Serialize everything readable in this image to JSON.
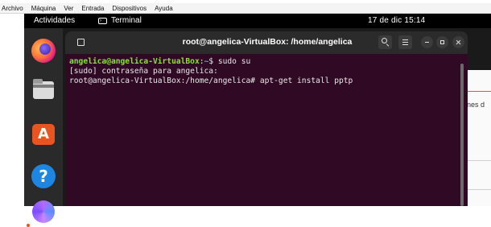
{
  "host_menubar": {
    "items": [
      "Archivo",
      "Máquina",
      "Ver",
      "Entrada",
      "Dispositivos",
      "Ayuda"
    ]
  },
  "gnome_topbar": {
    "activities": "Actividades",
    "app_name": "Terminal",
    "clock": "17 de dic  15:14"
  },
  "dock": {
    "icons": [
      "firefox-icon",
      "files-icon",
      "software-icon",
      "help-icon",
      "show-apps-icon"
    ]
  },
  "background_window": {
    "text": "nes d"
  },
  "terminal": {
    "title": "root@angelica-VirtualBox: /home/angelica",
    "lines": [
      {
        "user_host": "angelica@angelica-VirtualBox",
        "sep": ":",
        "path": "~",
        "cmd": "$ sudo su"
      },
      {
        "text": "[sudo] contraseña para angelica:"
      },
      {
        "text": "root@angelica-VirtualBox:/home/angelica# apt-get install pptp"
      }
    ]
  },
  "colors": {
    "terminal_bg": "#300a24",
    "titlebar_bg": "#2b2b2b",
    "prompt_green": "#8ae234",
    "prompt_blue": "#729fcf",
    "ubuntu_orange": "#e95420"
  }
}
